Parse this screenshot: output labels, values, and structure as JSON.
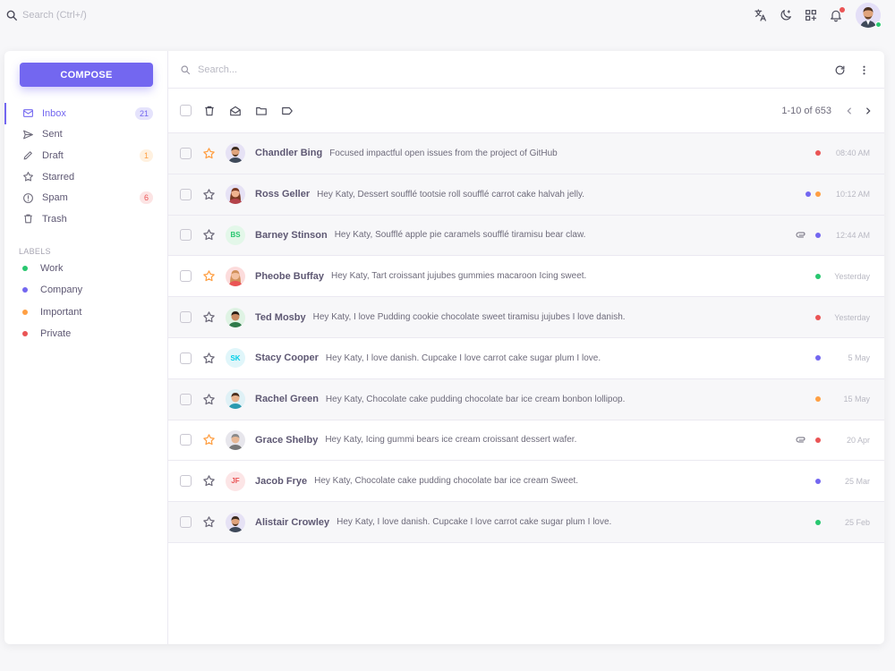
{
  "navbar": {
    "search_placeholder": "Search (Ctrl+/)",
    "icons": [
      "translate-icon",
      "moon-icon",
      "grid-plus-icon",
      "bell-icon"
    ]
  },
  "sidebar": {
    "compose_label": "COMPOSE",
    "folders": [
      {
        "label": "Inbox",
        "icon": "mail-icon",
        "badge": "21",
        "badge_type": "primary",
        "active": true
      },
      {
        "label": "Sent",
        "icon": "send-icon"
      },
      {
        "label": "Draft",
        "icon": "pencil-icon",
        "badge": "1",
        "badge_type": "warning"
      },
      {
        "label": "Starred",
        "icon": "star-icon"
      },
      {
        "label": "Spam",
        "icon": "info-icon",
        "badge": "6",
        "badge_type": "danger"
      },
      {
        "label": "Trash",
        "icon": "trash-icon"
      }
    ],
    "labels_title": "LABELS",
    "labels": [
      {
        "label": "Work",
        "color": "#28c76f"
      },
      {
        "label": "Company",
        "color": "#7367f0"
      },
      {
        "label": "Important",
        "color": "#ff9f43"
      },
      {
        "label": "Private",
        "color": "#ea5455"
      }
    ]
  },
  "mail": {
    "search_placeholder": "Search...",
    "pagination": "1-10 of 653",
    "emails": [
      {
        "sender": "Chandler Bing",
        "subject": "Focused impactful open issues from the project of GitHub",
        "time": "08:40 AM",
        "starred": true,
        "read": true,
        "attachment": false,
        "labels": [
          "#ea5455"
        ],
        "avatar": {
          "type": "img",
          "bg": "#e6e2f5"
        }
      },
      {
        "sender": "Ross Geller",
        "subject": "Hey Katy, Dessert soufflé tootsie roll soufflé carrot cake halvah jelly.",
        "time": "10:12 AM",
        "starred": false,
        "read": true,
        "attachment": false,
        "labels": [
          "#7367f0",
          "#ff9f43"
        ],
        "avatar": {
          "type": "img",
          "bg": "#e6e2f5"
        }
      },
      {
        "sender": "Barney Stinson",
        "subject": "Hey Katy, Soufflé apple pie caramels soufflé tiramisu bear claw.",
        "time": "12:44 AM",
        "starred": false,
        "read": true,
        "attachment": true,
        "labels": [
          "#7367f0"
        ],
        "avatar": {
          "type": "initials",
          "text": "BS",
          "bg": "#e3f7e9",
          "color": "#28c76f"
        }
      },
      {
        "sender": "Pheobe Buffay",
        "subject": "Hey Katy, Tart croissant jujubes gummies macaroon Icing sweet.",
        "time": "Yesterday",
        "starred": true,
        "read": false,
        "attachment": false,
        "labels": [
          "#28c76f"
        ],
        "avatar": {
          "type": "img",
          "bg": "#fcdcdc"
        }
      },
      {
        "sender": "Ted Mosby",
        "subject": "Hey Katy, I love Pudding cookie chocolate sweet tiramisu jujubes I love danish.",
        "time": "Yesterday",
        "starred": false,
        "read": true,
        "attachment": false,
        "labels": [
          "#ea5455"
        ],
        "avatar": {
          "type": "img",
          "bg": "#dff3e4"
        }
      },
      {
        "sender": "Stacy Cooper",
        "subject": "Hey Katy, I love danish. Cupcake I love carrot cake sugar plum I love.",
        "time": "5 May",
        "starred": false,
        "read": false,
        "attachment": false,
        "labels": [
          "#7367f0"
        ],
        "avatar": {
          "type": "initials",
          "text": "SK",
          "bg": "#e0f6fa",
          "color": "#00cfe8"
        }
      },
      {
        "sender": "Rachel Green",
        "subject": "Hey Katy, Chocolate cake pudding chocolate bar ice cream bonbon lollipop.",
        "time": "15 May",
        "starred": false,
        "read": true,
        "attachment": false,
        "labels": [
          "#ff9f43"
        ],
        "avatar": {
          "type": "img",
          "bg": "#dff1f6"
        }
      },
      {
        "sender": "Grace Shelby",
        "subject": "Hey Katy, Icing gummi bears ice cream croissant dessert wafer.",
        "time": "20 Apr",
        "starred": true,
        "read": false,
        "attachment": true,
        "labels": [
          "#ea5455"
        ],
        "avatar": {
          "type": "img",
          "bg": "#e7e6ec"
        }
      },
      {
        "sender": "Jacob Frye",
        "subject": "Hey Katy, Chocolate cake pudding chocolate bar ice cream Sweet.",
        "time": "25 Mar",
        "starred": false,
        "read": false,
        "attachment": false,
        "labels": [
          "#7367f0"
        ],
        "avatar": {
          "type": "initials",
          "text": "JF",
          "bg": "#fce5e6",
          "color": "#ea5455"
        }
      },
      {
        "sender": "Alistair Crowley",
        "subject": "Hey Katy, I love danish. Cupcake I love carrot cake sugar plum I love.",
        "time": "25 Feb",
        "starred": false,
        "read": true,
        "attachment": false,
        "labels": [
          "#28c76f"
        ],
        "avatar": {
          "type": "img",
          "bg": "#e6e2f5"
        }
      }
    ]
  },
  "colors": {
    "primary": "#7367f0",
    "success": "#28c76f",
    "warning": "#ff9f43",
    "danger": "#ea5455",
    "star_filled": "#ff9f43"
  }
}
